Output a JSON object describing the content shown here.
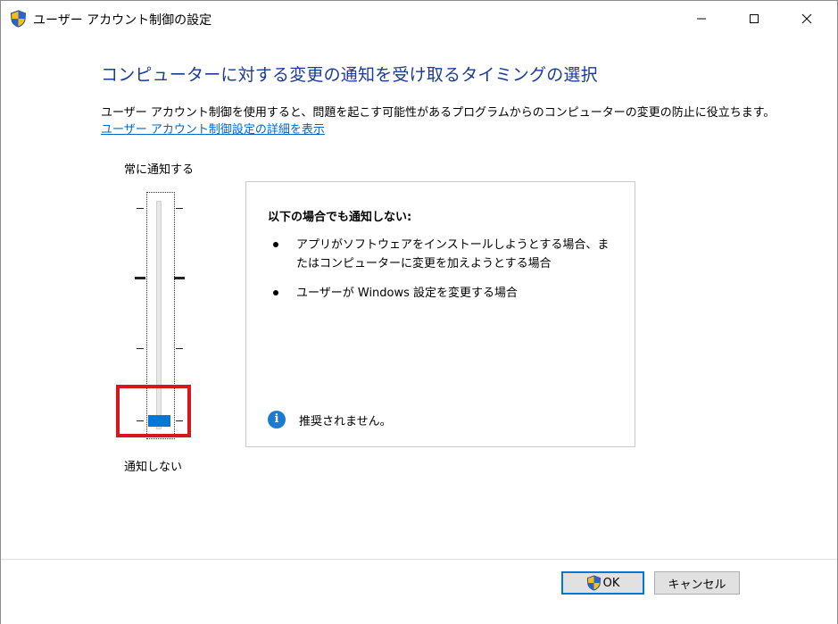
{
  "window": {
    "title": "ユーザー アカウント制御の設定",
    "icon": "uac-shield-icon",
    "controls": [
      "minimize-icon",
      "maximize-icon",
      "close-icon"
    ]
  },
  "main": {
    "heading": "コンピューターに対する変更の通知を受け取るタイミングの選択",
    "description": "ユーザー アカウント制御を使用すると、問題を起こす可能性があるプログラムからのコンピューターの変更の防止に役立ちます。",
    "link": "ユーザー アカウント制御設定の詳細を表示"
  },
  "slider": {
    "top_label": "常に通知する",
    "bottom_label": "通知しない",
    "levels": 4,
    "selected_level": 1,
    "thumb_color": "#0078d7",
    "highlight_color": "#d9161d"
  },
  "info": {
    "title": "以下の場合でも通知しない:",
    "items": [
      "アプリがソフトウェアをインストールしようとする場合、またはコンピューターに変更を加えようとする場合",
      "ユーザーが Windows 設定を変更する場合"
    ],
    "recommendation_icon": "info-icon",
    "recommendation": "推奨されません。"
  },
  "footer": {
    "ok_label": "OK",
    "cancel_label": "キャンセル"
  }
}
